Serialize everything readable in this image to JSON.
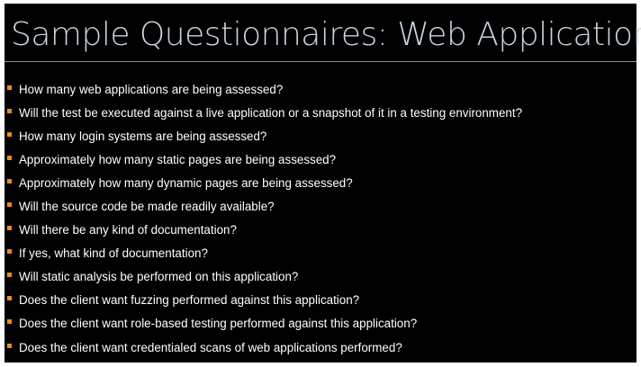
{
  "title": "Sample Questionnaires: Web Application",
  "bullet_color": "#f08a1c",
  "questions": [
    "How many web applications are being assessed?",
    "Will the test be executed against a live application or a snapshot of it in a testing environment?",
    "How many login systems are being assessed?",
    "Approximately how many static pages are being assessed?",
    "Approximately how many dynamic pages are being assessed?",
    "Will the source code be made readily available?",
    "Will there be any kind of documentation?",
    "If yes, what kind of documentation?",
    "Will static analysis be performed on this application?",
    "Does the client want fuzzing performed against this application?",
    "Does the client want role-based testing performed against this application?",
    "Does the client want credentialed scans of web applications performed?"
  ]
}
